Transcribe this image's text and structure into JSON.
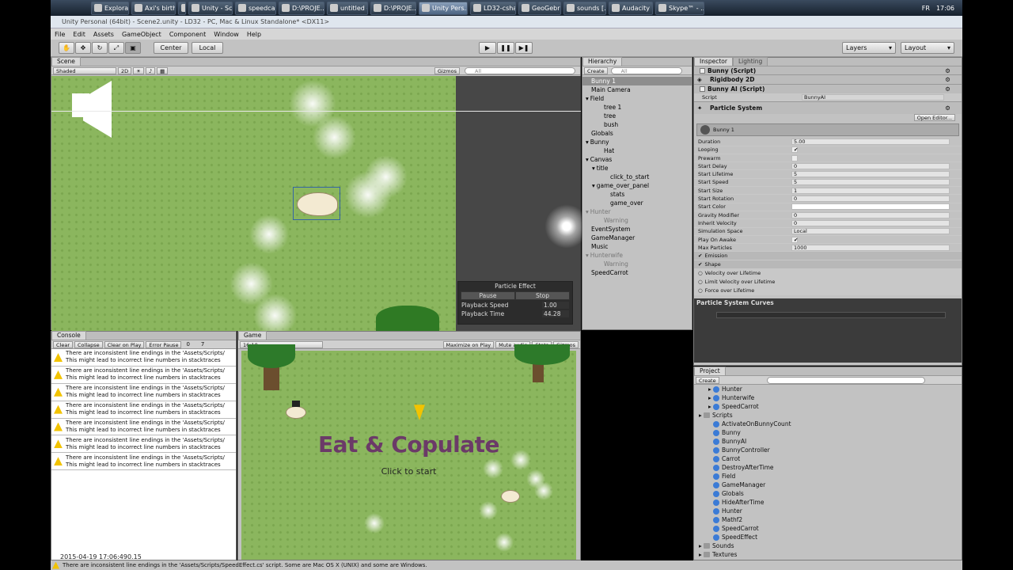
{
  "taskbar": {
    "items": [
      "Explorateur",
      "Axi's birth",
      "",
      "Unity - Scr...",
      "speedcarr...",
      "D:\\PROJE...",
      "untitled -...",
      "D:\\PROJE...",
      "Unity Pers...",
      "LD32-csha...",
      "GeoGebra",
      "sounds [...",
      "Audacity",
      "Skype™ - ..."
    ],
    "lang": "FR",
    "clock": "17:06"
  },
  "window": {
    "title": "Unity Personal (64bit) - Scene2.unity - LD32 - PC, Mac & Linux Standalone* <DX11>"
  },
  "menu": [
    "File",
    "Edit",
    "Assets",
    "GameObject",
    "Component",
    "Window",
    "Help"
  ],
  "toolbar": {
    "center": "Center",
    "local": "Local",
    "layers": "Layers",
    "layout": "Layout"
  },
  "scene": {
    "tab": "Scene",
    "shading": "Shaded",
    "mode2d": "2D",
    "gizmos": "Gizmos",
    "search": "All",
    "particle": {
      "title": "Particle Effect",
      "pause": "Pause",
      "stop": "Stop",
      "speed_label": "Playback Speed",
      "speed": "1.00",
      "time_label": "Playback Time",
      "time": "44.28"
    }
  },
  "hierarchy": {
    "tab": "Hierarchy",
    "create": "Create",
    "search": "All",
    "items": [
      {
        "t": "Bunny 1",
        "i": 0,
        "s": "sel"
      },
      {
        "t": "Main Camera",
        "i": 0
      },
      {
        "t": "Field",
        "i": 0,
        "a": 1
      },
      {
        "t": "tree 1",
        "i": 2
      },
      {
        "t": "tree",
        "i": 2
      },
      {
        "t": "bush",
        "i": 2
      },
      {
        "t": "Globals",
        "i": 0
      },
      {
        "t": "Bunny",
        "i": 0,
        "a": 1
      },
      {
        "t": "Hat",
        "i": 2
      },
      {
        "t": "Canvas",
        "i": 0,
        "a": 1
      },
      {
        "t": "title",
        "i": 1,
        "a": 1
      },
      {
        "t": "click_to_start",
        "i": 3
      },
      {
        "t": "game_over_panel",
        "i": 1,
        "a": 1
      },
      {
        "t": "stats",
        "i": 3
      },
      {
        "t": "game_over",
        "i": 3
      },
      {
        "t": "Hunter",
        "i": 0,
        "a": 1,
        "s": "dim"
      },
      {
        "t": "Warning",
        "i": 2,
        "s": "dim"
      },
      {
        "t": "EventSystem",
        "i": 0
      },
      {
        "t": "GameManager",
        "i": 0
      },
      {
        "t": "Music",
        "i": 0
      },
      {
        "t": "Hunterwife",
        "i": 0,
        "a": 1,
        "s": "dim"
      },
      {
        "t": "Warning",
        "i": 2,
        "s": "dim"
      },
      {
        "t": "SpeedCarrot",
        "i": 0
      }
    ]
  },
  "inspector": {
    "tab": "Inspector",
    "tab2": "Lighting",
    "comp1": "Bunny (Script)",
    "comp2": "Rigidbody 2D",
    "comp3": "Bunny AI (Script)",
    "script_label": "Script",
    "script_value": "BunnyAI",
    "ps_title": "Particle System",
    "open_editor": "Open Editor...",
    "ps_name": "Bunny 1",
    "props": [
      {
        "l": "Duration",
        "v": "5.00"
      },
      {
        "l": "Looping",
        "v": "✔"
      },
      {
        "l": "Prewarm",
        "v": ""
      },
      {
        "l": "Start Delay",
        "v": "0"
      },
      {
        "l": "Start Lifetime",
        "v": "5"
      },
      {
        "l": "Start Speed",
        "v": "5"
      },
      {
        "l": "Start Size",
        "v": "1"
      },
      {
        "l": "Start Rotation",
        "v": "0"
      },
      {
        "l": "Start Color",
        "v": ""
      },
      {
        "l": "Gravity Modifier",
        "v": "0"
      },
      {
        "l": "Inherit Velocity",
        "v": "0"
      },
      {
        "l": "Simulation Space",
        "v": "Local"
      },
      {
        "l": "Play On Awake",
        "v": "✔"
      },
      {
        "l": "Max Particles",
        "v": "1000"
      }
    ],
    "modules": [
      "Emission",
      "Shape",
      "Velocity over Lifetime",
      "Limit Velocity over Lifetime",
      "Force over Lifetime"
    ],
    "curves": "Particle System Curves"
  },
  "console": {
    "tab": "Console",
    "buttons": [
      "Clear",
      "Collapse",
      "Clear on Play",
      "Error Pause"
    ],
    "count0": "0",
    "count7": "7",
    "line1": "There are inconsistent line endings in the 'Assets/Scripts/",
    "line2": "This might lead to incorrect line numbers in stacktraces",
    "timestamp": "2015-04-19 17:06:490.15"
  },
  "game": {
    "tab": "Game",
    "aspect": "16:10",
    "maximize": "Maximize on Play",
    "mute": "Mute audio",
    "stats": "Stats",
    "gizmos": "Gizmos",
    "title": "Eat & Copulate",
    "subtitle": "Click to start"
  },
  "project": {
    "tab": "Project",
    "create": "Create",
    "items": [
      {
        "t": "Hunter",
        "i": 1,
        "k": "csi"
      },
      {
        "t": "Hunterwife",
        "i": 1,
        "k": "csi"
      },
      {
        "t": "SpeedCarrot",
        "i": 1,
        "k": "csi"
      },
      {
        "t": "Scripts",
        "i": 0,
        "k": "fold"
      },
      {
        "t": "ActivateOnBunnyCount",
        "i": 1,
        "k": "cs"
      },
      {
        "t": "Bunny",
        "i": 1,
        "k": "cs"
      },
      {
        "t": "BunnyAI",
        "i": 1,
        "k": "cs"
      },
      {
        "t": "BunnyController",
        "i": 1,
        "k": "cs"
      },
      {
        "t": "Carrot",
        "i": 1,
        "k": "cs"
      },
      {
        "t": "DestroyAfterTime",
        "i": 1,
        "k": "cs"
      },
      {
        "t": "Field",
        "i": 1,
        "k": "cs"
      },
      {
        "t": "GameManager",
        "i": 1,
        "k": "cs"
      },
      {
        "t": "Globals",
        "i": 1,
        "k": "cs"
      },
      {
        "t": "HideAfterTime",
        "i": 1,
        "k": "cs"
      },
      {
        "t": "Hunter",
        "i": 1,
        "k": "cs"
      },
      {
        "t": "Mathf2",
        "i": 1,
        "k": "cs"
      },
      {
        "t": "SpeedCarrot",
        "i": 1,
        "k": "cs"
      },
      {
        "t": "SpeedEffect",
        "i": 1,
        "k": "cs"
      },
      {
        "t": "Sounds",
        "i": 0,
        "k": "fold"
      },
      {
        "t": "Textures",
        "i": 0,
        "k": "fold"
      }
    ]
  },
  "status": {
    "text": "There are inconsistent line endings in the 'Assets/Scripts/SpeedEffect.cs' script. Some are Mac OS X (UNIX) and some are Windows."
  }
}
